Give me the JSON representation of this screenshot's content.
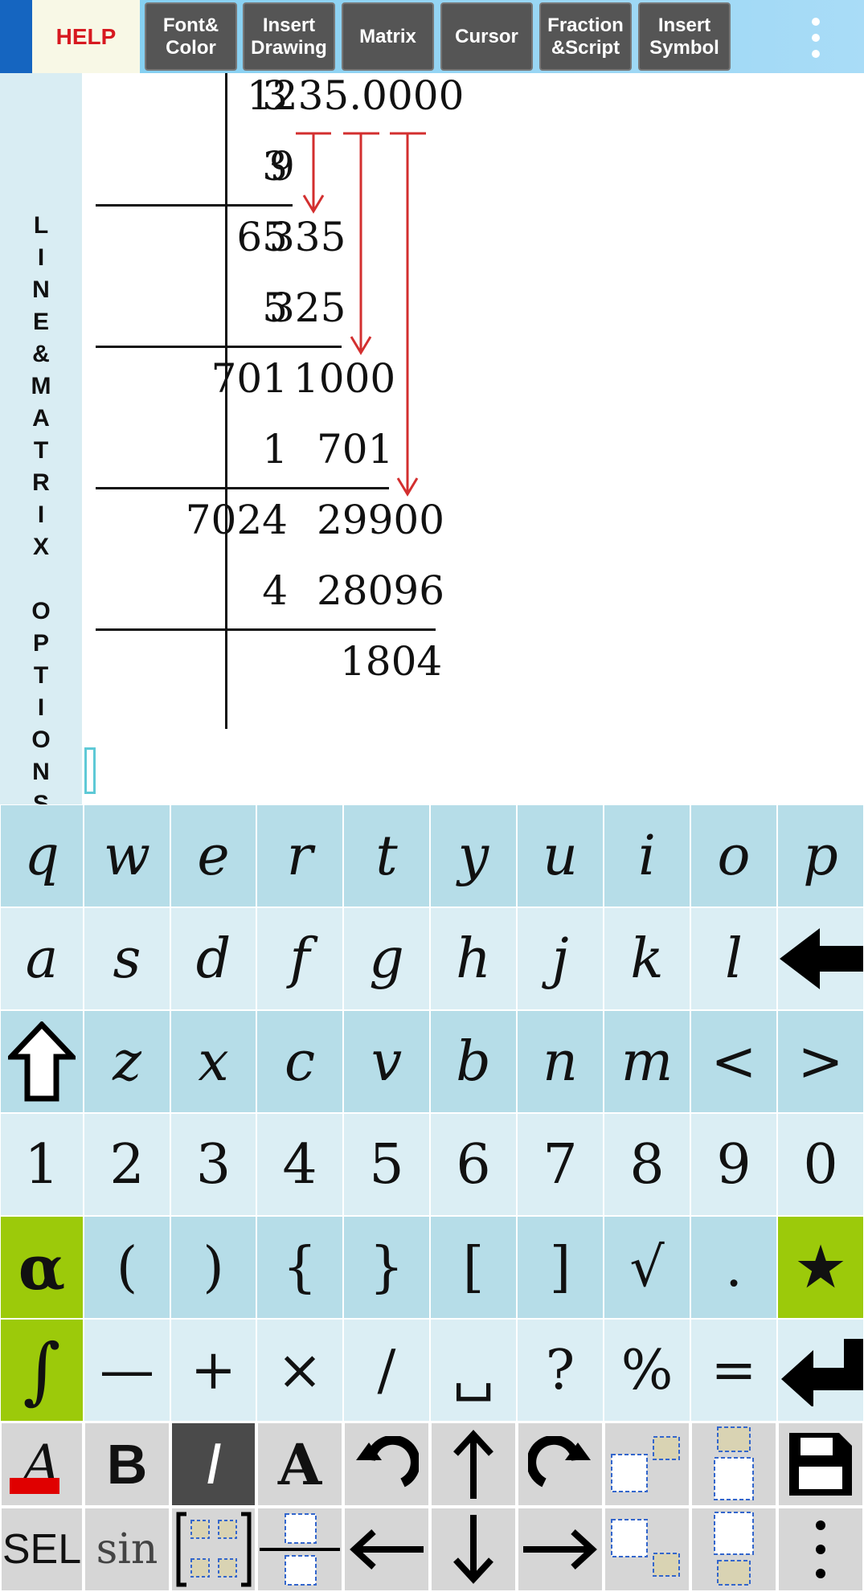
{
  "toolbar": {
    "help": "HELP",
    "buttons": [
      "Font&\nColor",
      "Insert\nDrawing",
      "Matrix",
      "Cursor",
      "Fraction\n&Script",
      "Insert\nSymbol"
    ],
    "menu_icon": "more-vertical-icon"
  },
  "side_panel": {
    "letters": [
      "L",
      "I",
      "N",
      "E",
      "&",
      "M",
      "A",
      "T",
      "R",
      "I",
      "X",
      "",
      "O",
      "P",
      "T",
      "I",
      "O",
      "N",
      "S"
    ]
  },
  "math": {
    "left": [
      "3",
      "3",
      "65",
      "5",
      "701",
      "1",
      "7024",
      "4"
    ],
    "right": [
      "1235.0000",
      "9",
      "335",
      "325",
      "1000",
      "701",
      "29900",
      "28096",
      "1804"
    ],
    "arrow_color": "#d32f2f"
  },
  "keyboard": {
    "row1": [
      "q",
      "w",
      "e",
      "r",
      "t",
      "y",
      "u",
      "i",
      "o",
      "p"
    ],
    "row2": [
      "a",
      "s",
      "d",
      "f",
      "g",
      "h",
      "j",
      "k",
      "l"
    ],
    "row3": [
      "z",
      "x",
      "c",
      "v",
      "b",
      "n",
      "m",
      "<",
      ">"
    ],
    "row4": [
      "1",
      "2",
      "3",
      "4",
      "5",
      "6",
      "7",
      "8",
      "9",
      "0"
    ],
    "row5": [
      "α",
      "(",
      ")",
      "{",
      "}",
      "[",
      "]",
      "√",
      ".",
      "★"
    ],
    "row6": [
      "∫",
      "—",
      "+",
      "×",
      "/",
      "␣",
      "?",
      "%",
      "="
    ],
    "tools1": [
      "A",
      "B",
      "I",
      "A"
    ],
    "tools2": [
      "SEL",
      "sin"
    ],
    "colors": {
      "dark": "#b6dde8",
      "light": "#dbeef4",
      "green": "#9cca0a",
      "tool": "#d6d6d6"
    }
  }
}
